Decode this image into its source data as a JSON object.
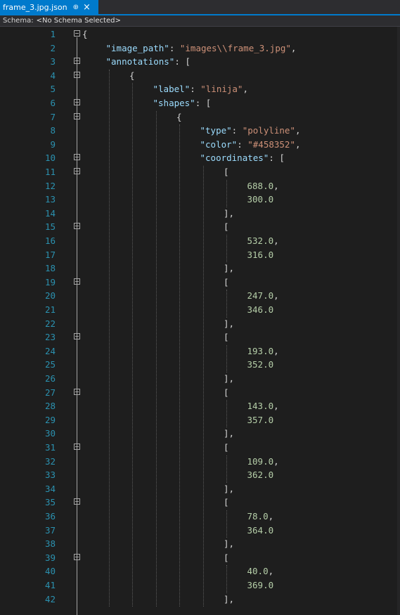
{
  "tab": {
    "title": "frame_3.jpg.json",
    "pin_icon": "pin-icon",
    "close_label": "×"
  },
  "schema": {
    "label": "Schema:",
    "value": "<No Schema Selected>"
  },
  "editor": {
    "colors": {
      "background": "#1e1e1e",
      "line_number": "#2b91af",
      "key": "#9cdcfe",
      "string": "#ce9178",
      "number": "#b5cea8",
      "accent": "#007acc"
    },
    "lines": [
      {
        "n": "1",
        "indent": 0,
        "tokens": [
          {
            "t": "{",
            "c": "punc"
          }
        ],
        "fold": true
      },
      {
        "n": "2",
        "indent": 1,
        "tokens": [
          {
            "t": "\"image_path\"",
            "c": "key"
          },
          {
            "t": ": ",
            "c": "punc"
          },
          {
            "t": "\"images\\\\frame_3.jpg\"",
            "c": "str"
          },
          {
            "t": ",",
            "c": "punc"
          }
        ]
      },
      {
        "n": "3",
        "indent": 1,
        "tokens": [
          {
            "t": "\"annotations\"",
            "c": "key"
          },
          {
            "t": ": [",
            "c": "punc"
          }
        ],
        "fold": true
      },
      {
        "n": "4",
        "indent": 2,
        "tokens": [
          {
            "t": "{",
            "c": "punc"
          }
        ],
        "fold": true
      },
      {
        "n": "5",
        "indent": 3,
        "tokens": [
          {
            "t": "\"label\"",
            "c": "key"
          },
          {
            "t": ": ",
            "c": "punc"
          },
          {
            "t": "\"linija\"",
            "c": "str"
          },
          {
            "t": ",",
            "c": "punc"
          }
        ]
      },
      {
        "n": "6",
        "indent": 3,
        "tokens": [
          {
            "t": "\"shapes\"",
            "c": "key"
          },
          {
            "t": ": [",
            "c": "punc"
          }
        ],
        "fold": true
      },
      {
        "n": "7",
        "indent": 4,
        "tokens": [
          {
            "t": "{",
            "c": "punc"
          }
        ],
        "fold": true
      },
      {
        "n": "8",
        "indent": 5,
        "tokens": [
          {
            "t": "\"type\"",
            "c": "key"
          },
          {
            "t": ": ",
            "c": "punc"
          },
          {
            "t": "\"polyline\"",
            "c": "str"
          },
          {
            "t": ",",
            "c": "punc"
          }
        ]
      },
      {
        "n": "9",
        "indent": 5,
        "tokens": [
          {
            "t": "\"color\"",
            "c": "key"
          },
          {
            "t": ": ",
            "c": "punc"
          },
          {
            "t": "\"#458352\"",
            "c": "str"
          },
          {
            "t": ",",
            "c": "punc"
          }
        ]
      },
      {
        "n": "10",
        "indent": 5,
        "tokens": [
          {
            "t": "\"coordinates\"",
            "c": "key"
          },
          {
            "t": ": [",
            "c": "punc"
          }
        ],
        "fold": true
      },
      {
        "n": "11",
        "indent": 6,
        "tokens": [
          {
            "t": "[",
            "c": "punc"
          }
        ],
        "fold": true
      },
      {
        "n": "12",
        "indent": 7,
        "tokens": [
          {
            "t": "688.0",
            "c": "num"
          },
          {
            "t": ",",
            "c": "punc"
          }
        ]
      },
      {
        "n": "13",
        "indent": 7,
        "tokens": [
          {
            "t": "300.0",
            "c": "num"
          }
        ]
      },
      {
        "n": "14",
        "indent": 6,
        "tokens": [
          {
            "t": "],",
            "c": "punc"
          }
        ]
      },
      {
        "n": "15",
        "indent": 6,
        "tokens": [
          {
            "t": "[",
            "c": "punc"
          }
        ],
        "fold": true
      },
      {
        "n": "16",
        "indent": 7,
        "tokens": [
          {
            "t": "532.0",
            "c": "num"
          },
          {
            "t": ",",
            "c": "punc"
          }
        ]
      },
      {
        "n": "17",
        "indent": 7,
        "tokens": [
          {
            "t": "316.0",
            "c": "num"
          }
        ]
      },
      {
        "n": "18",
        "indent": 6,
        "tokens": [
          {
            "t": "],",
            "c": "punc"
          }
        ]
      },
      {
        "n": "19",
        "indent": 6,
        "tokens": [
          {
            "t": "[",
            "c": "punc"
          }
        ],
        "fold": true
      },
      {
        "n": "20",
        "indent": 7,
        "tokens": [
          {
            "t": "247.0",
            "c": "num"
          },
          {
            "t": ",",
            "c": "punc"
          }
        ]
      },
      {
        "n": "21",
        "indent": 7,
        "tokens": [
          {
            "t": "346.0",
            "c": "num"
          }
        ]
      },
      {
        "n": "22",
        "indent": 6,
        "tokens": [
          {
            "t": "],",
            "c": "punc"
          }
        ]
      },
      {
        "n": "23",
        "indent": 6,
        "tokens": [
          {
            "t": "[",
            "c": "punc"
          }
        ],
        "fold": true
      },
      {
        "n": "24",
        "indent": 7,
        "tokens": [
          {
            "t": "193.0",
            "c": "num"
          },
          {
            "t": ",",
            "c": "punc"
          }
        ]
      },
      {
        "n": "25",
        "indent": 7,
        "tokens": [
          {
            "t": "352.0",
            "c": "num"
          }
        ]
      },
      {
        "n": "26",
        "indent": 6,
        "tokens": [
          {
            "t": "],",
            "c": "punc"
          }
        ]
      },
      {
        "n": "27",
        "indent": 6,
        "tokens": [
          {
            "t": "[",
            "c": "punc"
          }
        ],
        "fold": true
      },
      {
        "n": "28",
        "indent": 7,
        "tokens": [
          {
            "t": "143.0",
            "c": "num"
          },
          {
            "t": ",",
            "c": "punc"
          }
        ]
      },
      {
        "n": "29",
        "indent": 7,
        "tokens": [
          {
            "t": "357.0",
            "c": "num"
          }
        ]
      },
      {
        "n": "30",
        "indent": 6,
        "tokens": [
          {
            "t": "],",
            "c": "punc"
          }
        ]
      },
      {
        "n": "31",
        "indent": 6,
        "tokens": [
          {
            "t": "[",
            "c": "punc"
          }
        ],
        "fold": true
      },
      {
        "n": "32",
        "indent": 7,
        "tokens": [
          {
            "t": "109.0",
            "c": "num"
          },
          {
            "t": ",",
            "c": "punc"
          }
        ]
      },
      {
        "n": "33",
        "indent": 7,
        "tokens": [
          {
            "t": "362.0",
            "c": "num"
          }
        ]
      },
      {
        "n": "34",
        "indent": 6,
        "tokens": [
          {
            "t": "],",
            "c": "punc"
          }
        ]
      },
      {
        "n": "35",
        "indent": 6,
        "tokens": [
          {
            "t": "[",
            "c": "punc"
          }
        ],
        "fold": true
      },
      {
        "n": "36",
        "indent": 7,
        "tokens": [
          {
            "t": "78.0",
            "c": "num"
          },
          {
            "t": ",",
            "c": "punc"
          }
        ]
      },
      {
        "n": "37",
        "indent": 7,
        "tokens": [
          {
            "t": "364.0",
            "c": "num"
          }
        ]
      },
      {
        "n": "38",
        "indent": 6,
        "tokens": [
          {
            "t": "],",
            "c": "punc"
          }
        ]
      },
      {
        "n": "39",
        "indent": 6,
        "tokens": [
          {
            "t": "[",
            "c": "punc"
          }
        ],
        "fold": true
      },
      {
        "n": "40",
        "indent": 7,
        "tokens": [
          {
            "t": "40.0",
            "c": "num"
          },
          {
            "t": ",",
            "c": "punc"
          }
        ]
      },
      {
        "n": "41",
        "indent": 7,
        "tokens": [
          {
            "t": "369.0",
            "c": "num"
          }
        ]
      },
      {
        "n": "42",
        "indent": 6,
        "tokens": [
          {
            "t": "],",
            "c": "punc"
          }
        ]
      }
    ]
  }
}
